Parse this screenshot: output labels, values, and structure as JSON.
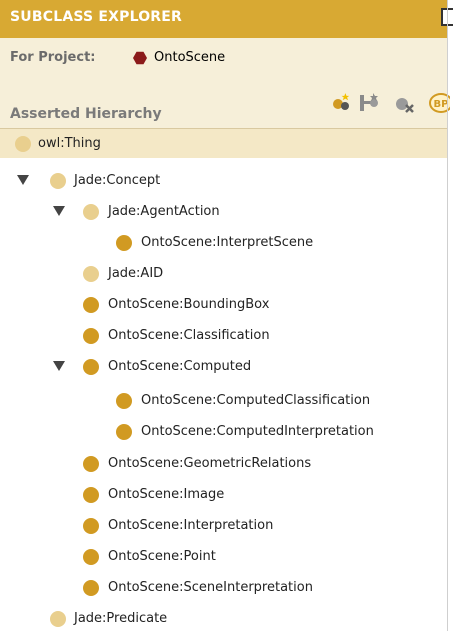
{
  "panel": {
    "title": "SUBCLASS EXPLORER",
    "project_label": "For Project:",
    "project_name": "OntoScene",
    "hierarchy_label": "Asserted Hierarchy",
    "toolbar_bp_label": "BP"
  },
  "colors": {
    "header_bg": "#d8a933",
    "project_icon": "#8b1a1a",
    "class_light": "#e9cf8e",
    "class_dark": "#d19a22",
    "selected_row": "#f4e8c6"
  },
  "tree": [
    {
      "label": "owl:Thing"
    },
    {
      "label": "Jade:Concept"
    },
    {
      "label": "Jade:AgentAction"
    },
    {
      "label": "OntoScene:InterpretScene"
    },
    {
      "label": "Jade:AID"
    },
    {
      "label": "OntoScene:BoundingBox"
    },
    {
      "label": "OntoScene:Classification"
    },
    {
      "label": "OntoScene:Computed"
    },
    {
      "label": "OntoScene:ComputedClassification"
    },
    {
      "label": "OntoScene:ComputedInterpretation"
    },
    {
      "label": "OntoScene:GeometricRelations"
    },
    {
      "label": "OntoScene:Image"
    },
    {
      "label": "OntoScene:Interpretation"
    },
    {
      "label": "OntoScene:Point"
    },
    {
      "label": "OntoScene:SceneInterpretation"
    },
    {
      "label": "Jade:Predicate"
    }
  ]
}
